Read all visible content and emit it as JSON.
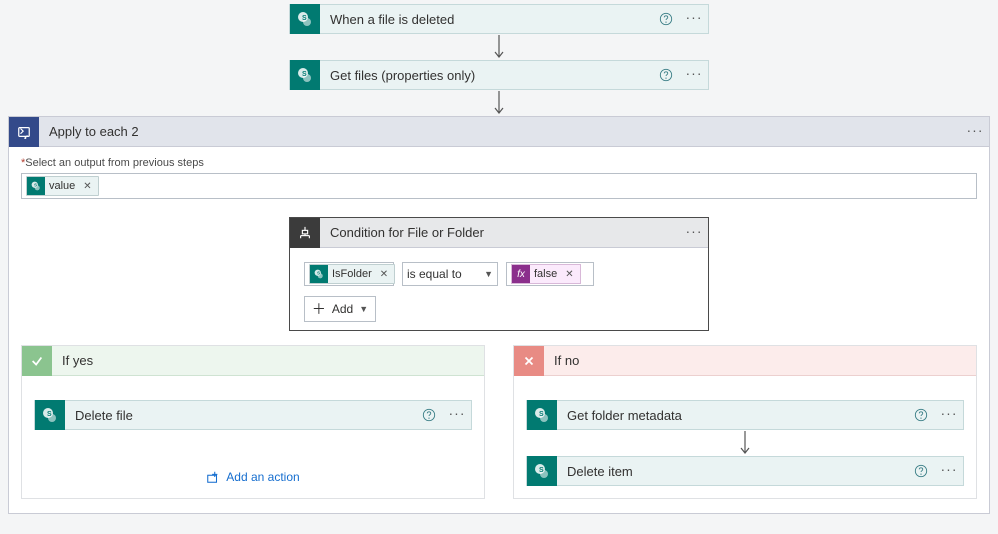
{
  "triggers": {
    "t1_title": "When a file is deleted",
    "t2_title": "Get files (properties only)"
  },
  "apply_to_each": {
    "title": "Apply to each 2",
    "input_label": "Select an output from previous steps",
    "token_value": "value"
  },
  "condition": {
    "title": "Condition for File or Folder",
    "left_token": "IsFolder",
    "operator": "is equal to",
    "right_token": "false",
    "add_label": "Add"
  },
  "branches": {
    "yes_label": "If yes",
    "no_label": "If no",
    "yes_actions": {
      "a1": "Delete file"
    },
    "no_actions": {
      "a1": "Get folder metadata",
      "a2": "Delete item"
    },
    "add_action_label": "Add an action"
  }
}
